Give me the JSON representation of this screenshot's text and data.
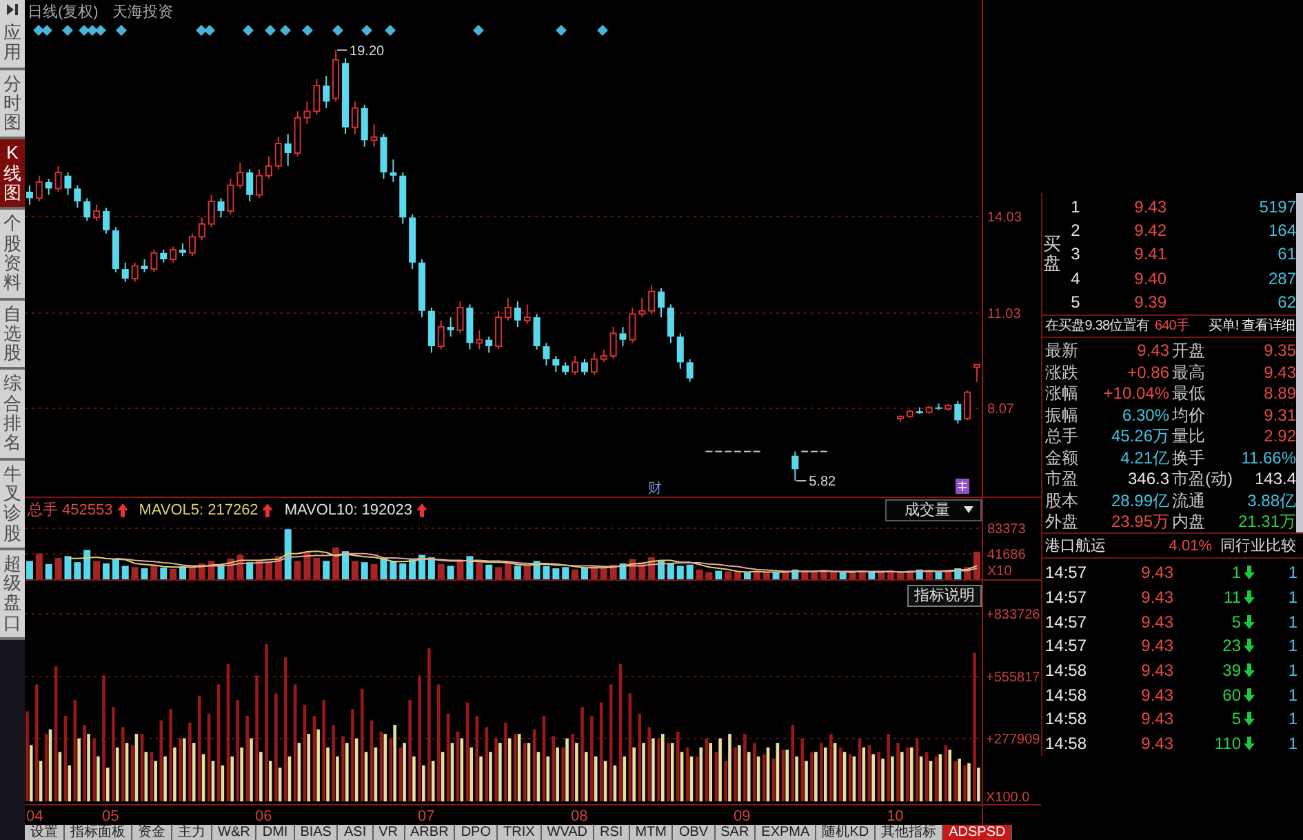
{
  "sidebar": {
    "items": [
      {
        "label": "应用",
        "selected": false
      },
      {
        "label": "分时图",
        "selected": false
      },
      {
        "label": "K线图",
        "selected": true
      },
      {
        "label": "个股资料",
        "selected": false
      },
      {
        "label": "自选股",
        "selected": false
      },
      {
        "label": "综合排名",
        "selected": false
      },
      {
        "label": "牛叉诊股",
        "selected": false
      },
      {
        "label": "超级盘口",
        "selected": false
      }
    ]
  },
  "chart": {
    "title": "日线(复权)",
    "stock_name": "天海投资",
    "chart_data": {
      "type": "candlestick",
      "ohlc": [
        [
          14.8,
          15.0,
          14.4,
          14.6
        ],
        [
          14.6,
          15.3,
          14.5,
          15.1
        ],
        [
          15.1,
          15.2,
          14.7,
          14.9
        ],
        [
          14.9,
          15.6,
          14.8,
          15.4
        ],
        [
          15.3,
          15.4,
          14.7,
          14.9
        ],
        [
          14.9,
          15.0,
          14.3,
          14.5
        ],
        [
          14.5,
          14.6,
          13.9,
          14.0
        ],
        [
          14.0,
          14.4,
          13.9,
          14.2
        ],
        [
          14.2,
          14.3,
          13.5,
          13.6
        ],
        [
          13.6,
          13.7,
          12.3,
          12.4
        ],
        [
          12.4,
          12.6,
          12.0,
          12.1
        ],
        [
          12.1,
          12.6,
          12.0,
          12.5
        ],
        [
          12.5,
          12.7,
          12.3,
          12.4
        ],
        [
          12.4,
          13.0,
          12.3,
          12.9
        ],
        [
          12.9,
          13.0,
          12.6,
          12.7
        ],
        [
          12.7,
          13.1,
          12.6,
          13.0
        ],
        [
          13.0,
          13.2,
          12.8,
          12.9
        ],
        [
          12.9,
          13.5,
          12.8,
          13.4
        ],
        [
          13.4,
          14.0,
          13.3,
          13.8
        ],
        [
          13.8,
          14.7,
          13.7,
          14.5
        ],
        [
          14.5,
          14.6,
          14.0,
          14.2
        ],
        [
          14.2,
          15.2,
          14.1,
          15.0
        ],
        [
          15.0,
          15.7,
          14.9,
          15.4
        ],
        [
          15.4,
          15.5,
          14.5,
          14.7
        ],
        [
          14.7,
          15.5,
          14.6,
          15.3
        ],
        [
          15.3,
          15.9,
          15.2,
          15.6
        ],
        [
          15.6,
          16.5,
          15.5,
          16.3
        ],
        [
          16.3,
          16.6,
          15.6,
          16.0
        ],
        [
          16.0,
          17.3,
          15.9,
          17.1
        ],
        [
          17.1,
          17.6,
          16.9,
          17.3
        ],
        [
          17.3,
          18.3,
          17.2,
          18.1
        ],
        [
          18.1,
          18.4,
          17.4,
          17.6
        ],
        [
          17.7,
          19.2,
          17.6,
          18.9
        ],
        [
          18.8,
          18.95,
          16.6,
          16.8
        ],
        [
          16.8,
          17.6,
          16.6,
          17.4
        ],
        [
          17.4,
          17.5,
          16.2,
          16.4
        ],
        [
          16.4,
          16.9,
          16.2,
          16.5
        ],
        [
          16.5,
          16.6,
          15.2,
          15.4
        ],
        [
          15.4,
          15.8,
          15.1,
          15.3
        ],
        [
          15.3,
          15.4,
          13.8,
          14.0
        ],
        [
          14.0,
          14.1,
          12.4,
          12.6
        ],
        [
          12.6,
          12.7,
          10.9,
          11.1
        ],
        [
          11.1,
          11.2,
          9.8,
          10.0
        ],
        [
          10.0,
          10.8,
          9.9,
          10.6
        ],
        [
          10.6,
          10.9,
          10.3,
          10.5
        ],
        [
          10.5,
          11.4,
          10.4,
          11.2
        ],
        [
          11.2,
          11.3,
          9.9,
          10.1
        ],
        [
          10.1,
          10.5,
          9.9,
          10.2
        ],
        [
          10.2,
          10.3,
          9.8,
          10.0
        ],
        [
          10.0,
          11.1,
          9.9,
          10.9
        ],
        [
          10.9,
          11.5,
          10.8,
          11.2
        ],
        [
          11.2,
          11.4,
          10.6,
          10.8
        ],
        [
          10.8,
          11.3,
          10.7,
          10.9
        ],
        [
          10.9,
          11.0,
          9.9,
          10.0
        ],
        [
          10.0,
          10.1,
          9.4,
          9.6
        ],
        [
          9.6,
          9.7,
          9.2,
          9.4
        ],
        [
          9.4,
          9.5,
          9.1,
          9.2
        ],
        [
          9.2,
          9.7,
          9.1,
          9.5
        ],
        [
          9.5,
          9.6,
          9.1,
          9.2
        ],
        [
          9.2,
          9.8,
          9.1,
          9.6
        ],
        [
          9.6,
          9.9,
          9.5,
          9.7
        ],
        [
          9.7,
          10.6,
          9.6,
          10.4
        ],
        [
          10.4,
          10.6,
          10.0,
          10.2
        ],
        [
          10.2,
          11.2,
          10.1,
          11.0
        ],
        [
          11.0,
          11.5,
          10.9,
          11.1
        ],
        [
          11.1,
          11.9,
          11.0,
          11.7
        ],
        [
          11.7,
          11.8,
          10.9,
          11.2
        ],
        [
          11.2,
          11.3,
          10.1,
          10.3
        ],
        [
          10.3,
          10.4,
          9.3,
          9.5
        ],
        [
          9.5,
          9.6,
          8.9,
          9.0
        ],
        null,
        [
          6.73,
          6.73,
          6.73,
          6.73
        ],
        [
          6.73,
          6.73,
          6.73,
          6.73
        ],
        [
          6.73,
          6.73,
          6.73,
          6.73
        ],
        [
          6.73,
          6.73,
          6.73,
          6.73
        ],
        [
          6.73,
          6.73,
          6.73,
          6.73
        ],
        [
          6.73,
          6.73,
          6.73,
          6.73
        ],
        null,
        null,
        null,
        [
          6.6,
          6.73,
          5.82,
          6.18
        ],
        [
          6.73,
          6.73,
          6.73,
          6.73
        ],
        [
          6.73,
          6.73,
          6.73,
          6.73
        ],
        [
          6.73,
          6.73,
          6.73,
          6.73
        ],
        null,
        null,
        null,
        null,
        null,
        null,
        null,
        [
          7.75,
          7.85,
          7.65,
          7.82
        ],
        [
          7.82,
          8.02,
          7.78,
          7.98
        ],
        [
          7.98,
          8.1,
          7.9,
          7.92
        ],
        [
          7.95,
          8.15,
          7.9,
          8.1
        ],
        [
          8.1,
          8.22,
          8.02,
          8.06
        ],
        [
          8.05,
          8.2,
          8.0,
          8.16
        ],
        [
          8.2,
          8.3,
          7.6,
          7.7
        ],
        [
          7.75,
          8.62,
          7.7,
          8.57
        ],
        [
          9.35,
          9.43,
          8.89,
          9.43
        ]
      ],
      "ylim": [
        5.33,
        19.6
      ],
      "yticks": [
        14.03,
        11.03,
        8.07
      ],
      "grid": true,
      "annotations": [
        "19.20",
        "5.82"
      ]
    },
    "event_marks": [
      {
        "kind": "text",
        "label": "财"
      },
      {
        "kind": "badge"
      }
    ],
    "x_axis_labels": [
      "04",
      "05",
      "06",
      "07",
      "08",
      "09",
      "10"
    ]
  },
  "volume": {
    "legend": [
      {
        "label": "总手",
        "value": "452553",
        "color": "#e04848",
        "up": true
      },
      {
        "label": "MAVOL5:",
        "value": "217262",
        "color": "#e0d070",
        "up": true
      },
      {
        "label": "MAVOL10:",
        "value": "192023",
        "color": "#e0e0e0",
        "up": true
      }
    ],
    "selector": "成交量",
    "unit_label": "X10",
    "chart_data": {
      "type": "bar",
      "series": [
        {
          "values": [
            30000,
            42000,
            25000,
            35000,
            38000,
            28000,
            48000,
            30000,
            26000,
            33000,
            22000,
            20000,
            18000,
            24000,
            19000,
            17000,
            21000,
            20000,
            26000,
            30000,
            24000,
            34000,
            40000,
            28000,
            31000,
            29000,
            38000,
            82000,
            30000,
            44000,
            35000,
            30000,
            52000,
            46000,
            30000,
            28000,
            25000,
            34000,
            30000,
            26000,
            33000,
            40000,
            36000,
            25000,
            22000,
            30000,
            38000,
            28000,
            24000,
            20000,
            26000,
            22000,
            24000,
            30000,
            22000,
            18000,
            20000,
            16000,
            19000,
            22000,
            18000,
            24000,
            26000,
            33000,
            28000,
            36000,
            30000,
            26000,
            22000,
            24000,
            16000,
            12000,
            14000,
            13000,
            12000,
            11000,
            13000,
            12000,
            11000,
            14000,
            16000,
            13000,
            12000,
            14000,
            12000,
            11000,
            13000,
            14000,
            12000,
            11000,
            13000,
            12000,
            14000,
            16000,
            13000,
            12000,
            15000,
            18000,
            20000,
            45000
          ],
          "colors": [
            "#58d8ec",
            "#a82424",
            "#58d8ec",
            "#a82424",
            "#58d8ec",
            "#58d8ec",
            "#58d8ec",
            "#a82424",
            "#58d8ec",
            "#58d8ec",
            "#58d8ec",
            "#a82424",
            "#58d8ec",
            "#a82424",
            "#58d8ec",
            "#a82424",
            "#58d8ec",
            "#a82424",
            "#a82424",
            "#a82424",
            "#58d8ec",
            "#a82424",
            "#a82424",
            "#58d8ec",
            "#a82424",
            "#a82424",
            "#a82424",
            "#58d8ec",
            "#a82424",
            "#a82424",
            "#a82424",
            "#58d8ec",
            "#a82424",
            "#58d8ec",
            "#a82424",
            "#58d8ec",
            "#a82424",
            "#58d8ec",
            "#58d8ec",
            "#58d8ec",
            "#58d8ec",
            "#58d8ec",
            "#58d8ec",
            "#a82424",
            "#58d8ec",
            "#a82424",
            "#58d8ec",
            "#a82424",
            "#58d8ec",
            "#a82424",
            "#a82424",
            "#58d8ec",
            "#a82424",
            "#58d8ec",
            "#58d8ec",
            "#58d8ec",
            "#58d8ec",
            "#a82424",
            "#58d8ec",
            "#a82424",
            "#a82424",
            "#a82424",
            "#58d8ec",
            "#a82424",
            "#a82424",
            "#a82424",
            "#58d8ec",
            "#58d8ec",
            "#58d8ec",
            "#58d8ec",
            "#a82424",
            "#a82424",
            "#58d8ec",
            "#a82424",
            "#a82424",
            "#58d8ec",
            "#a82424",
            "#a82424",
            "#58d8ec",
            "#a82424",
            "#58d8ec",
            "#a82424",
            "#a82424",
            "#a82424",
            "#a82424",
            "#58d8ec",
            "#a82424",
            "#a82424",
            "#58d8ec",
            "#a82424",
            "#a82424",
            "#a82424",
            "#a82424",
            "#58d8ec",
            "#a82424",
            "#58d8ec",
            "#a82424",
            "#58d8ec",
            "#a82424",
            "#a82424"
          ]
        },
        {
          "type": "line",
          "color": "#e0d070",
          "values": [
            null,
            null,
            null,
            null,
            34000,
            34000,
            35000,
            36000,
            34000,
            33000,
            32000,
            26000,
            24000,
            23000,
            21000,
            20000,
            20000,
            20000,
            21000,
            23000,
            24000,
            27000,
            31000,
            31000,
            31000,
            32000,
            33000,
            42000,
            42000,
            45000,
            46000,
            44000,
            38000,
            41000,
            39000,
            37000,
            36000,
            33000,
            29000,
            29000,
            30000,
            33000,
            33000,
            32000,
            31000,
            31000,
            30000,
            29000,
            28000,
            28000,
            27000,
            24000,
            23000,
            24000,
            25000,
            23000,
            23000,
            21000,
            19000,
            19000,
            19000,
            20000,
            22000,
            25000,
            26000,
            29000,
            31000,
            31000,
            28000,
            28000,
            24000,
            20000,
            18000,
            16000,
            13000,
            12000,
            13000,
            12000,
            12000,
            12000,
            13000,
            13000,
            13000,
            14000,
            13000,
            12000,
            12000,
            13000,
            12000,
            12000,
            13000,
            12000,
            12000,
            13000,
            14000,
            13000,
            14000,
            15000,
            16000,
            22000
          ]
        },
        {
          "type": "line",
          "color": "#e0a8a8",
          "values": [
            null,
            null,
            null,
            null,
            null,
            null,
            null,
            null,
            null,
            34000,
            33000,
            31000,
            30000,
            29000,
            27000,
            26000,
            23000,
            22000,
            22000,
            22000,
            22000,
            23000,
            26000,
            26000,
            27000,
            28000,
            30000,
            36000,
            37000,
            38000,
            39000,
            39000,
            40000,
            42000,
            42000,
            42000,
            40000,
            35000,
            35000,
            34000,
            33000,
            34000,
            33000,
            31000,
            30000,
            30000,
            31000,
            31000,
            30000,
            30000,
            29000,
            27000,
            26000,
            26000,
            26000,
            25000,
            23000,
            22000,
            22000,
            22000,
            21000,
            21000,
            22000,
            22000,
            22000,
            24000,
            25000,
            26000,
            27000,
            27000,
            27000,
            25000,
            24000,
            22000,
            21000,
            18000,
            16000,
            15000,
            14000,
            13000,
            13000,
            13000,
            13000,
            13000,
            13000,
            13000,
            13000,
            13000,
            13000,
            13000,
            13000,
            12000,
            13000,
            13000,
            13000,
            13000,
            13000,
            14000,
            14000,
            18000
          ]
        }
      ],
      "ylim": [
        0,
        135200
      ],
      "yticks": [
        83373,
        41686
      ],
      "grid": true
    }
  },
  "indicator": {
    "button": "指标说明",
    "unit_label": "X100.0",
    "chart_data": {
      "type": "bar",
      "series": [
        {
          "color": "#9a1818",
          "values": [
            400000,
            520000,
            300000,
            600000,
            380000,
            450000,
            340000,
            280000,
            560000,
            420000,
            330000,
            250000,
            300000,
            220000,
            360000,
            410000,
            280000,
            350000,
            470000,
            390000,
            520000,
            610000,
            450000,
            380000,
            560000,
            700000,
            480000,
            640000,
            520000,
            430000,
            380000,
            450000,
            340000,
            290000,
            410000,
            500000,
            360000,
            310000,
            280000,
            240000,
            450000,
            560000,
            680000,
            520000,
            390000,
            310000,
            440000,
            380000,
            330000,
            280000,
            350000,
            300000,
            260000,
            320000,
            380000,
            290000,
            240000,
            300000,
            420000,
            380000,
            440000,
            520000,
            610000,
            480000,
            390000,
            330000,
            280000,
            260000,
            310000,
            240000,
            200000,
            280000,
            220000,
            180000,
            240000,
            300000,
            260000,
            210000,
            190000,
            230000,
            340000,
            280000,
            220000,
            260000,
            300000,
            240000,
            210000,
            280000,
            250000,
            220000,
            300000,
            260000,
            240000,
            280000,
            220000,
            200000,
            250000,
            180000,
            160000,
            660000
          ]
        },
        {
          "color": "#e6dfa0",
          "values": [
            250000,
            180000,
            320000,
            220000,
            160000,
            280000,
            300000,
            200000,
            150000,
            240000,
            260000,
            300000,
            220000,
            180000,
            200000,
            240000,
            280000,
            260000,
            210000,
            180000,
            160000,
            200000,
            240000,
            280000,
            220000,
            180000,
            150000,
            200000,
            260000,
            300000,
            320000,
            240000,
            200000,
            260000,
            280000,
            220000,
            240000,
            300000,
            340000,
            260000,
            200000,
            160000,
            180000,
            220000,
            260000,
            280000,
            240000,
            200000,
            220000,
            260000,
            280000,
            300000,
            260000,
            220000,
            200000,
            240000,
            280000,
            260000,
            220000,
            200000,
            180000,
            160000,
            200000,
            240000,
            260000,
            280000,
            300000,
            260000,
            220000,
            200000,
            240000,
            260000,
            280000,
            300000,
            250000,
            220000,
            200000,
            240000,
            260000,
            230000,
            200000,
            180000,
            220000,
            240000,
            260000,
            220000,
            200000,
            240000,
            210000,
            190000,
            200000,
            220000,
            240000,
            200000,
            180000,
            210000,
            230000,
            190000,
            170000,
            150000
          ]
        }
      ],
      "ylim": [
        0,
        864400
      ],
      "yticks": [
        {
          "value": 833726,
          "label": "+833726"
        },
        {
          "value": 555817,
          "label": "+555817"
        },
        {
          "value": 277909,
          "label": "+277909"
        }
      ],
      "grid": true
    }
  },
  "bottom_tabs": [
    {
      "label": "设置",
      "selected": false
    },
    {
      "label": "指标面板",
      "selected": false
    },
    {
      "label": "资金",
      "selected": false
    },
    {
      "label": "主力",
      "selected": false
    },
    {
      "label": "W&R",
      "selected": false
    },
    {
      "label": "DMI",
      "selected": false
    },
    {
      "label": "BIAS",
      "selected": false
    },
    {
      "label": "ASI",
      "selected": false
    },
    {
      "label": "VR",
      "selected": false
    },
    {
      "label": "ARBR",
      "selected": false
    },
    {
      "label": "DPO",
      "selected": false
    },
    {
      "label": "TRIX",
      "selected": false
    },
    {
      "label": "WVAD",
      "selected": false
    },
    {
      "label": "RSI",
      "selected": false
    },
    {
      "label": "MTM",
      "selected": false
    },
    {
      "label": "OBV",
      "selected": false
    },
    {
      "label": "SAR",
      "selected": false
    },
    {
      "label": "EXPMA",
      "selected": false
    },
    {
      "label": "随机KD",
      "selected": false
    },
    {
      "label": "其他指标",
      "selected": false
    },
    {
      "label": "ADSPSD",
      "selected": true
    }
  ],
  "order_book": {
    "side_label": "买盘",
    "rows": [
      {
        "rank": "1",
        "price": "9.43",
        "volume": "5197"
      },
      {
        "rank": "2",
        "price": "9.42",
        "volume": "164"
      },
      {
        "rank": "3",
        "price": "9.41",
        "volume": "61"
      },
      {
        "rank": "4",
        "price": "9.40",
        "volume": "287"
      },
      {
        "rank": "5",
        "price": "9.39",
        "volume": "62"
      }
    ]
  },
  "notice": {
    "text": "在买盘9.38位置有",
    "amount": "640手",
    "link": "买单! 查看详细"
  },
  "quote": [
    {
      "label": "最新",
      "value": "9.43",
      "color": "#e84848"
    },
    {
      "label": "开盘",
      "value": "9.35",
      "color": "#e84848"
    },
    {
      "label": "涨跌",
      "value": "+0.86",
      "color": "#e84848"
    },
    {
      "label": "最高",
      "value": "9.43",
      "color": "#e84848"
    },
    {
      "label": "涨幅",
      "value": "+10.04%",
      "color": "#e84848"
    },
    {
      "label": "最低",
      "value": "8.89",
      "color": "#e84848"
    },
    {
      "label": "振幅",
      "value": "6.30%",
      "color": "#40c4e0"
    },
    {
      "label": "均价",
      "value": "9.31",
      "color": "#e84848"
    },
    {
      "label": "总手",
      "value": "45.26万",
      "color": "#40c4e0"
    },
    {
      "label": "量比",
      "value": "2.92",
      "color": "#e84848"
    },
    {
      "label": "金额",
      "value": "4.21亿",
      "color": "#40c4e0"
    },
    {
      "label": "换手",
      "value": "11.66%",
      "color": "#40c4e0"
    },
    {
      "label": "市盈",
      "value": "346.3",
      "color": "#e8e8e8"
    },
    {
      "label": "市盈(动)",
      "value": "143.4",
      "color": "#e8e8e8"
    },
    {
      "label": "股本",
      "value": "28.99亿",
      "color": "#40c4e0"
    },
    {
      "label": "流通",
      "value": "3.88亿",
      "color": "#40c4e0"
    },
    {
      "label": "外盘",
      "value": "23.95万",
      "color": "#e84848"
    },
    {
      "label": "内盘",
      "value": "21.31万",
      "color": "#30d040"
    }
  ],
  "trades": {
    "industry": "港口航运",
    "change": "4.01%",
    "compare_link": "同行业比较",
    "rows": [
      {
        "time": "14:57",
        "price": "9.43",
        "volume": "1",
        "up": false,
        "column_4": "1"
      },
      {
        "time": "14:57",
        "price": "9.43",
        "volume": "11",
        "up": false,
        "column_4": "1"
      },
      {
        "time": "14:57",
        "price": "9.43",
        "volume": "5",
        "up": false,
        "column_4": "1"
      },
      {
        "time": "14:57",
        "price": "9.43",
        "volume": "23",
        "up": false,
        "column_4": "1"
      },
      {
        "time": "14:58",
        "price": "9.43",
        "volume": "39",
        "up": false,
        "column_4": "1"
      },
      {
        "time": "14:58",
        "price": "9.43",
        "volume": "60",
        "up": false,
        "column_4": "1"
      },
      {
        "time": "14:58",
        "price": "9.43",
        "volume": "5",
        "up": false,
        "column_4": "1"
      },
      {
        "time": "14:58",
        "price": "9.43",
        "volume": "110",
        "up": false,
        "column_4": "1"
      }
    ]
  }
}
